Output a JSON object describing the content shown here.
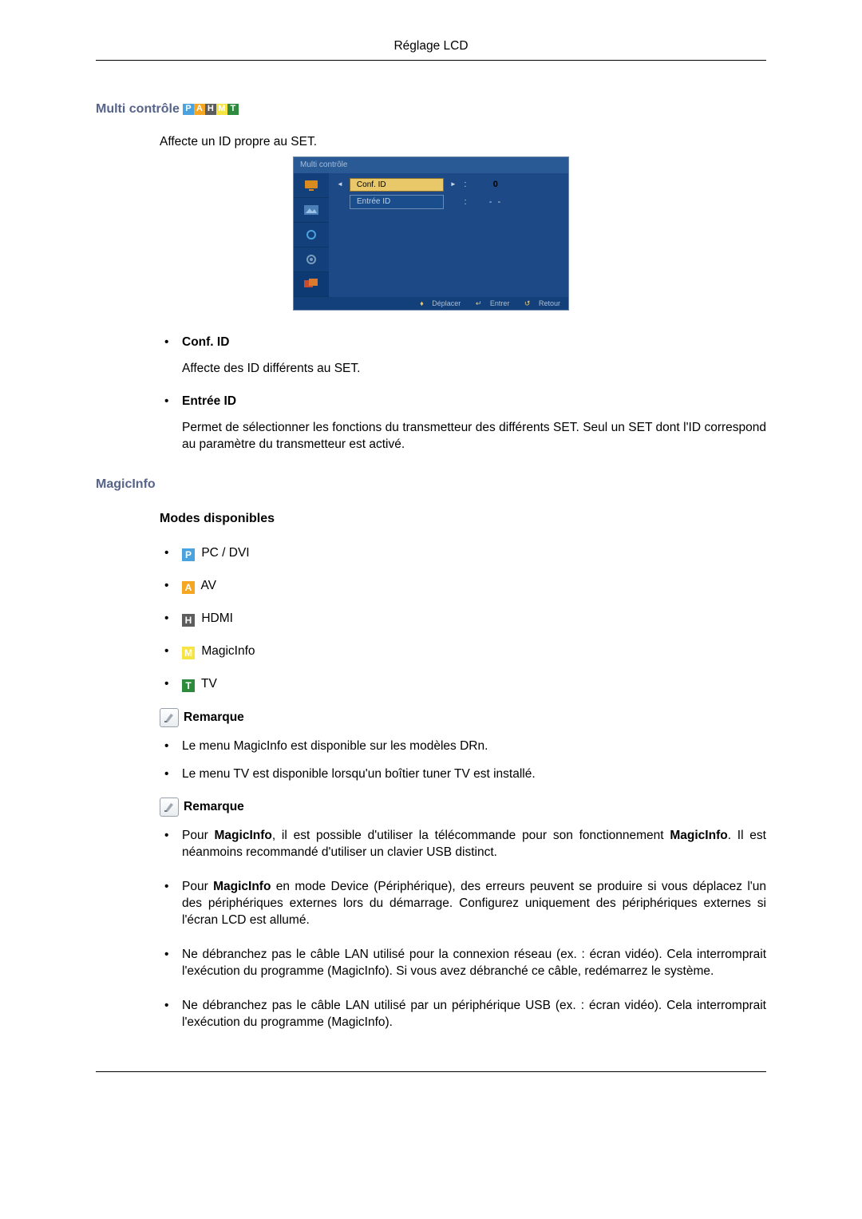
{
  "header": {
    "title": "Réglage LCD"
  },
  "multi_controle": {
    "title": "Multi contrôle",
    "intro": "Affecte un ID propre au SET.",
    "osd": {
      "title": "Multi contrôle",
      "conf_id_label": "Conf. ID",
      "conf_id_value": "0",
      "entree_id_label": "Entrée ID",
      "entree_id_value": "- -",
      "footer_move": "Déplacer",
      "footer_enter": "Entrer",
      "footer_return": "Retour"
    },
    "items": [
      {
        "title": "Conf. ID",
        "body": "Affecte des ID différents au SET."
      },
      {
        "title": "Entrée ID",
        "body": "Permet de sélectionner les fonctions du transmetteur des différents SET. Seul un SET dont l'ID correspond au paramètre du transmetteur est activé."
      }
    ]
  },
  "magicinfo": {
    "title": "MagicInfo",
    "modes_title": "Modes disponibles",
    "modes": [
      {
        "badge": "P",
        "label": "PC / DVI"
      },
      {
        "badge": "A",
        "label": "AV"
      },
      {
        "badge": "H",
        "label": "HDMI"
      },
      {
        "badge": "M",
        "label": "MagicInfo"
      },
      {
        "badge": "T",
        "label": "TV"
      }
    ],
    "remarque_label": "Remarque",
    "notes1": [
      "Le menu MagicInfo est disponible sur les modèles DRn.",
      "Le menu TV est disponible lorsqu'un boîtier tuner TV est installé."
    ],
    "notes2": [
      {
        "pre": "Pour ",
        "b1": "MagicInfo",
        "mid": ", il est possible d'utiliser la télécommande pour son fonctionnement ",
        "b2": "MagicInfo",
        "post": ". Il est néanmoins recommandé d'utiliser un clavier USB distinct."
      },
      {
        "pre": "Pour ",
        "b1": "MagicInfo",
        "mid": " en mode Device (Périphérique), des erreurs peuvent se produire si vous déplacez l'un des périphériques externes lors du démarrage. Configurez uniquement des périphériques externes si l'écran LCD est allumé.",
        "b2": "",
        "post": ""
      },
      {
        "plain": "Ne débranchez pas le câble LAN utilisé pour la connexion réseau (ex. : écran vidéo). Cela interromprait l'exécution du programme (MagicInfo). Si vous avez débranché ce câble, redémarrez le système."
      },
      {
        "plain": "Ne débranchez pas le câble LAN utilisé par un périphérique USB (ex. : écran vidéo). Cela interromprait l'exécution du programme (MagicInfo)."
      }
    ]
  }
}
